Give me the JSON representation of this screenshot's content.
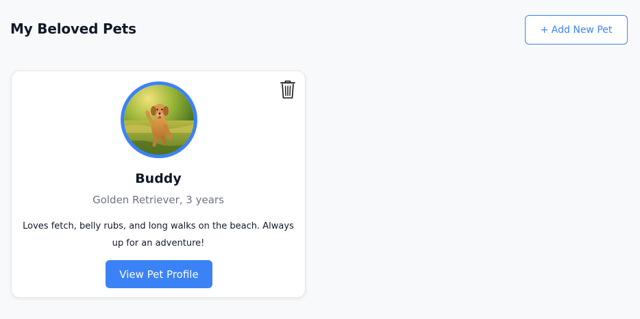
{
  "header": {
    "title": "My Beloved Pets",
    "add_button_label": "+ Add New Pet"
  },
  "pets": [
    {
      "name": "Buddy",
      "breed_age": "Golden Retriever, 3 years",
      "description": "Loves fetch, belly rubs, and long walks on the beach. Always up for an adventure!",
      "view_button_label": "View Pet Profile",
      "delete_icon": "trash-icon",
      "photo": "golden-retriever-running-in-grass"
    }
  ],
  "colors": {
    "accent": "#3b82f6",
    "background": "#f8f9fb",
    "card": "#ffffff",
    "muted_text": "#6b7280"
  }
}
